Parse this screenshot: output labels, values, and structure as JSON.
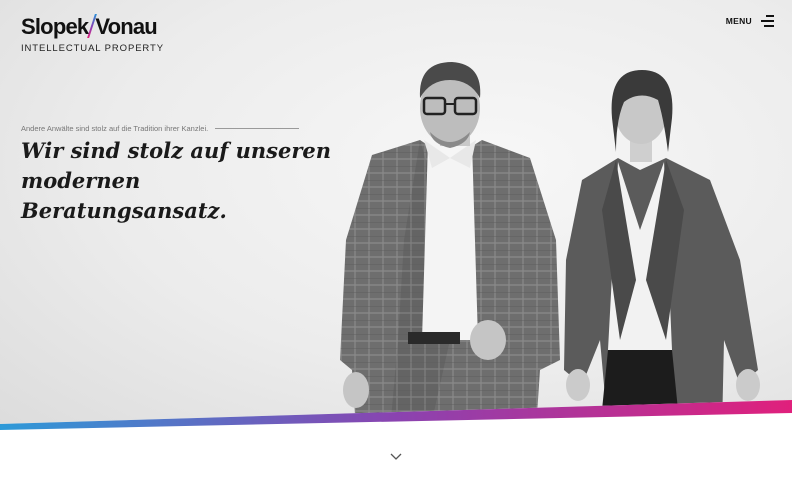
{
  "header": {
    "logo_name_left": "Slopek",
    "logo_name_right": "Vonau",
    "logo_subtitle": "INTELLECTUAL PROPERTY",
    "menu_label": "MENU",
    "menu_icon": "hamburger-icon"
  },
  "hero": {
    "kicker": "Andere Anwälte sind stolz auf die Tradition ihrer Kanzlei.",
    "headline_line1": "Wir sind stolz auf unseren",
    "headline_line2": "modernen Beratungsansatz.",
    "photo_icon": "team-photo"
  },
  "band_colors": {
    "start": "#2d9ad8",
    "mid": "#8a43b0",
    "end": "#e0207c"
  },
  "scroll": {
    "icon": "chevron-down-icon"
  }
}
